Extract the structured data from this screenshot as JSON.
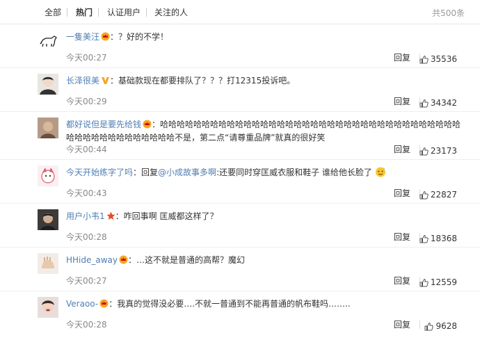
{
  "tabs": [
    {
      "label": "全部"
    },
    {
      "label": "热门"
    },
    {
      "label": "认证用户"
    },
    {
      "label": "关注的人"
    }
  ],
  "total": "共500条",
  "reply_label": "回复",
  "comments": [
    {
      "user": "一隻美汪",
      "badge": "crown-badge",
      "text": "？好的不学！",
      "time": "今天00:27",
      "likes": "35536"
    },
    {
      "user": "长泽很美",
      "badge": "verified-v-badge",
      "text": "基础款现在都要排队了？？？打12315投诉吧。",
      "time": "今天00:29",
      "likes": "34342"
    },
    {
      "user": "都好说但是要先给钱",
      "badge": "crown-badge",
      "text": "哈哈哈哈哈哈哈哈哈哈哈哈哈哈哈哈哈哈哈哈哈哈哈哈哈哈哈哈哈哈哈哈哈哈哈哈哈哈哈哈哈哈哈哈哈哈哈哈哈不是，第二点“请尊重品牌”就真的很好笑",
      "time": "今天00:44",
      "likes": "23173"
    },
    {
      "user": "今天开始练字了吗",
      "badge": "",
      "text_prefix": "回复",
      "mention": "@小成故事多啊",
      "text": ":还要同时穿匡威衣服和鞋子 谁给他长脸了",
      "time": "今天00:43",
      "likes": "22827"
    },
    {
      "user": "用户小韦1",
      "badge": "star-badge",
      "text": "咋回事啊 匡威都这样了？",
      "time": "今天00:28",
      "likes": "18368"
    },
    {
      "user": "HHide_away",
      "badge": "crown-badge",
      "text": "…这不就是普通的高帮？魔幻",
      "time": "今天00:27",
      "likes": "12559"
    },
    {
      "user": "Veraoo-",
      "badge": "crown-badge",
      "text": "我真的觉得没必要….不就一普通到不能再普通的帆布鞋吗……..",
      "time": "今天00:28",
      "likes": "9628"
    }
  ]
}
